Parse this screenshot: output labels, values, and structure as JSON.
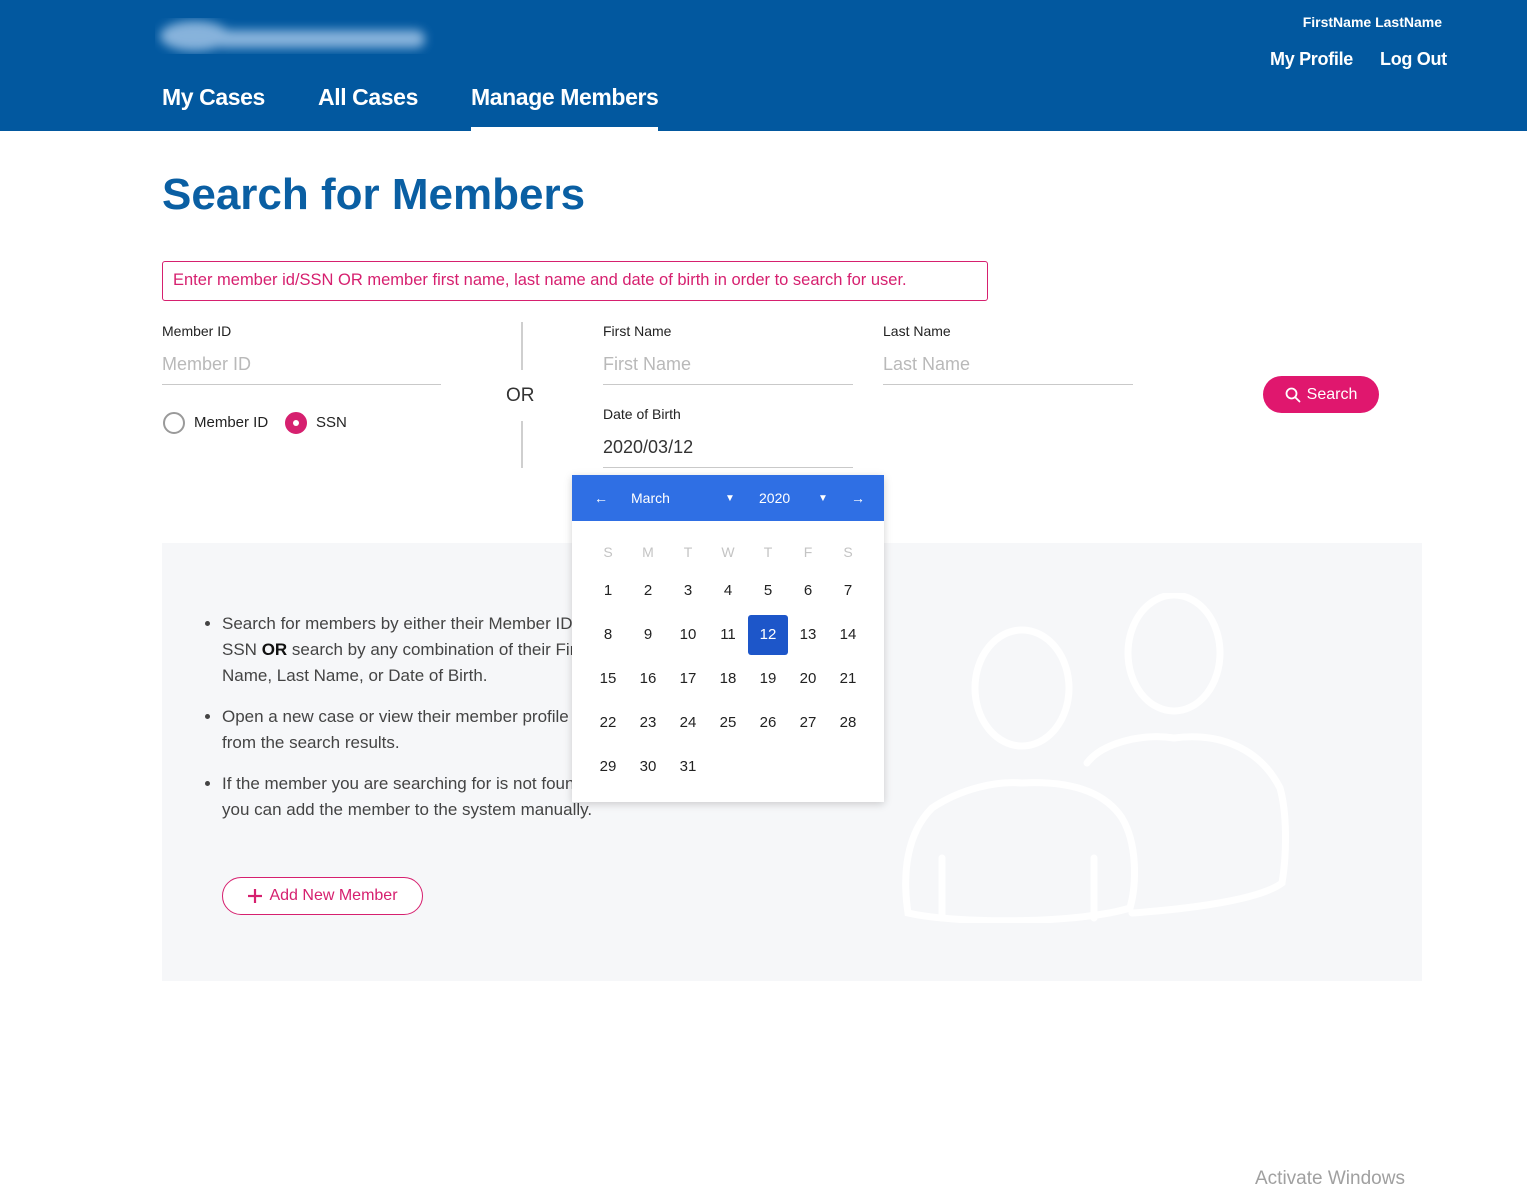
{
  "header": {
    "user_name": "FirstName LastName",
    "my_profile": "My Profile",
    "log_out": "Log Out",
    "tabs": [
      {
        "label": "My Cases"
      },
      {
        "label": "All Cases"
      },
      {
        "label": "Manage Members",
        "active": true
      }
    ]
  },
  "page": {
    "title": "Search for Members",
    "notice": "Enter member id/SSN OR member first name, last name and date of birth in order to search for user."
  },
  "form": {
    "member_id_label": "Member ID",
    "member_id_placeholder": "Member ID",
    "radio_member_id": "Member ID",
    "radio_ssn": "SSN",
    "selected_radio": "SSN",
    "or_text": "OR",
    "first_name_label": "First Name",
    "first_name_placeholder": "First Name",
    "last_name_label": "Last Name",
    "last_name_placeholder": "Last Name",
    "dob_label": "Date of Birth",
    "dob_value": "2020/03/12",
    "search_button": "Search"
  },
  "calendar": {
    "month": "March",
    "year": "2020",
    "weekdays": [
      "S",
      "M",
      "T",
      "W",
      "T",
      "F",
      "S"
    ],
    "selected_day": 12,
    "days": [
      "1",
      "2",
      "3",
      "4",
      "5",
      "6",
      "7",
      "8",
      "9",
      "10",
      "11",
      "12",
      "13",
      "14",
      "15",
      "16",
      "17",
      "18",
      "19",
      "20",
      "21",
      "22",
      "23",
      "24",
      "25",
      "26",
      "27",
      "28",
      "29",
      "30",
      "31"
    ]
  },
  "info": {
    "bullet1_a": "Search for members by either their Member ID or SSN ",
    "bullet1_strong": "OR",
    "bullet1_b": " search by any combination of their First Name, Last Name, or Date of Birth.",
    "bullet2": "Open a new case or view their member profile from the search results.",
    "bullet3": "If the member you are searching for is not found, you can add the member to the system manually.",
    "add_button": "Add New Member"
  },
  "watermark": "Activate Windows",
  "colors": {
    "brand_blue": "#02589f",
    "accent_pink": "#e0176e",
    "calendar_blue": "#2f6fe4",
    "selected_day": "#1d56c9"
  }
}
